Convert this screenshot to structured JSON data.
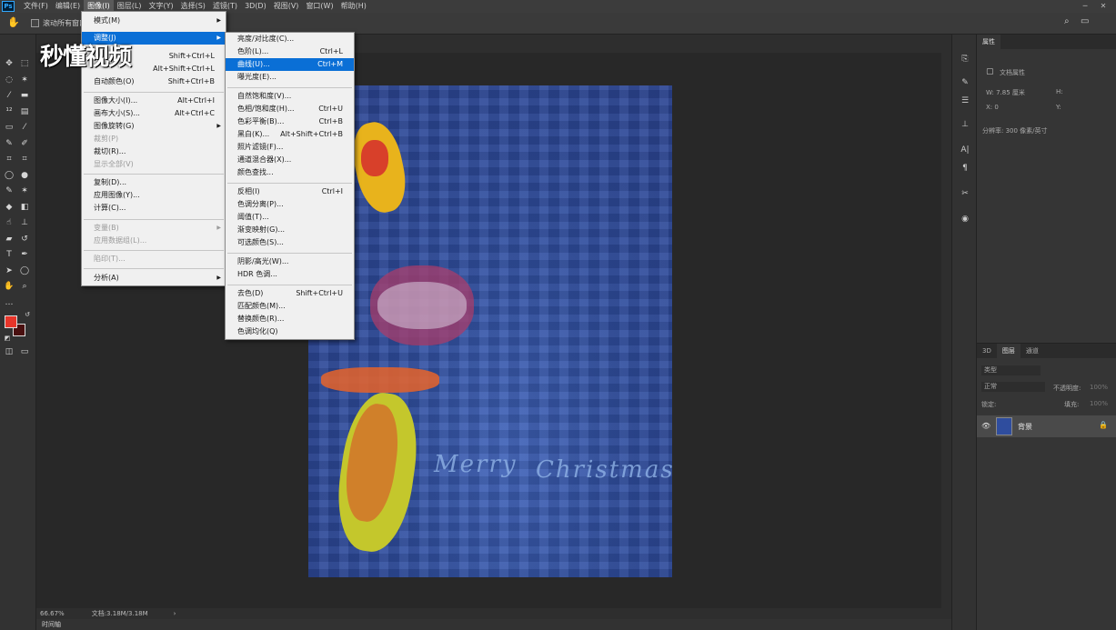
{
  "app": {
    "logo": "Ps"
  },
  "menubar": {
    "items": [
      "文件(F)",
      "编辑(E)",
      "图像(I)",
      "图层(L)",
      "文字(Y)",
      "选择(S)",
      "滤镜(T)",
      "3D(D)",
      "视图(V)",
      "窗口(W)",
      "帮助(H)"
    ],
    "active_index": 2
  },
  "options": {
    "checkbox_label": "滚动所有窗口"
  },
  "image_menu": {
    "items": [
      {
        "label": "模式(M)",
        "shortcut": "",
        "submenu": true,
        "disabled": false
      },
      {
        "label": "调整(J)",
        "shortcut": "",
        "submenu": true,
        "disabled": false,
        "highlighted": true
      },
      {
        "label": "",
        "shortcut": "Shift+Ctrl+L",
        "submenu": false,
        "disabled": false
      },
      {
        "label": "",
        "shortcut": "Alt+Shift+Ctrl+L",
        "submenu": false,
        "disabled": false
      },
      {
        "label": "自动颜色(O)",
        "shortcut": "Shift+Ctrl+B",
        "submenu": false,
        "disabled": false
      },
      {
        "label": "图像大小(I)...",
        "shortcut": "Alt+Ctrl+I",
        "submenu": false,
        "disabled": false
      },
      {
        "label": "画布大小(S)...",
        "shortcut": "Alt+Ctrl+C",
        "submenu": false,
        "disabled": false
      },
      {
        "label": "图像旋转(G)",
        "shortcut": "",
        "submenu": true,
        "disabled": false
      },
      {
        "label": "裁剪(P)",
        "shortcut": "",
        "submenu": false,
        "disabled": true
      },
      {
        "label": "裁切(R)...",
        "shortcut": "",
        "submenu": false,
        "disabled": false
      },
      {
        "label": "显示全部(V)",
        "shortcut": "",
        "submenu": false,
        "disabled": true
      },
      {
        "label": "复制(D)...",
        "shortcut": "",
        "submenu": false,
        "disabled": false
      },
      {
        "label": "应用图像(Y)...",
        "shortcut": "",
        "submenu": false,
        "disabled": false
      },
      {
        "label": "计算(C)...",
        "shortcut": "",
        "submenu": false,
        "disabled": false
      },
      {
        "label": "变量(B)",
        "shortcut": "",
        "submenu": true,
        "disabled": true
      },
      {
        "label": "应用数据组(L)...",
        "shortcut": "",
        "submenu": false,
        "disabled": true
      },
      {
        "label": "陷印(T)...",
        "shortcut": "",
        "submenu": false,
        "disabled": true
      },
      {
        "label": "分析(A)",
        "shortcut": "",
        "submenu": true,
        "disabled": false
      }
    ]
  },
  "adjust_menu": {
    "items": [
      {
        "label": "亮度/对比度(C)...",
        "shortcut": ""
      },
      {
        "label": "色阶(L)...",
        "shortcut": "Ctrl+L"
      },
      {
        "label": "曲线(U)...",
        "shortcut": "Ctrl+M",
        "highlighted": true
      },
      {
        "label": "曝光度(E)...",
        "shortcut": ""
      },
      {
        "label": "自然饱和度(V)...",
        "shortcut": ""
      },
      {
        "label": "色相/饱和度(H)...",
        "shortcut": "Ctrl+U"
      },
      {
        "label": "色彩平衡(B)...",
        "shortcut": "Ctrl+B"
      },
      {
        "label": "黑白(K)...",
        "shortcut": "Alt+Shift+Ctrl+B"
      },
      {
        "label": "照片滤镜(F)...",
        "shortcut": ""
      },
      {
        "label": "通道混合器(X)...",
        "shortcut": ""
      },
      {
        "label": "颜色查找...",
        "shortcut": ""
      },
      {
        "label": "反相(I)",
        "shortcut": "Ctrl+I"
      },
      {
        "label": "色调分离(P)...",
        "shortcut": ""
      },
      {
        "label": "阈值(T)...",
        "shortcut": ""
      },
      {
        "label": "渐变映射(G)...",
        "shortcut": ""
      },
      {
        "label": "可选颜色(S)...",
        "shortcut": ""
      },
      {
        "label": "阴影/高光(W)...",
        "shortcut": ""
      },
      {
        "label": "HDR 色调...",
        "shortcut": ""
      },
      {
        "label": "去色(D)",
        "shortcut": "Shift+Ctrl+U"
      },
      {
        "label": "匹配颜色(M)...",
        "shortcut": ""
      },
      {
        "label": "替换颜色(R)...",
        "shortcut": ""
      },
      {
        "label": "色调均化(Q)",
        "shortcut": ""
      }
    ]
  },
  "status": {
    "zoom": "66.67%",
    "doc_info": "文档:3.18M/3.18M",
    "timeline": "时间轴"
  },
  "properties": {
    "tab": "属性",
    "doc_props": "文档属性",
    "w": "W: 7.85 厘米",
    "h": "H:",
    "x": "X: 0",
    "y": "Y:",
    "resolution": "分辨率: 300 像素/英寸"
  },
  "layers": {
    "tabs": [
      "3D",
      "图层",
      "通道"
    ],
    "kind": "类型",
    "blend_mode": "正常",
    "opacity_label": "不透明度:",
    "opacity_value": "100%",
    "lock_label": "锁定:",
    "fill_label": "填充:",
    "fill_value": "100%",
    "layer_name": "背景"
  },
  "canvas": {
    "text1": "Merry",
    "text2": "Christmas"
  },
  "watermark": "秒懂视频",
  "colors": {
    "foreground": "#e8352a",
    "background": "#4a1010",
    "highlight": "#0a6fd6"
  }
}
